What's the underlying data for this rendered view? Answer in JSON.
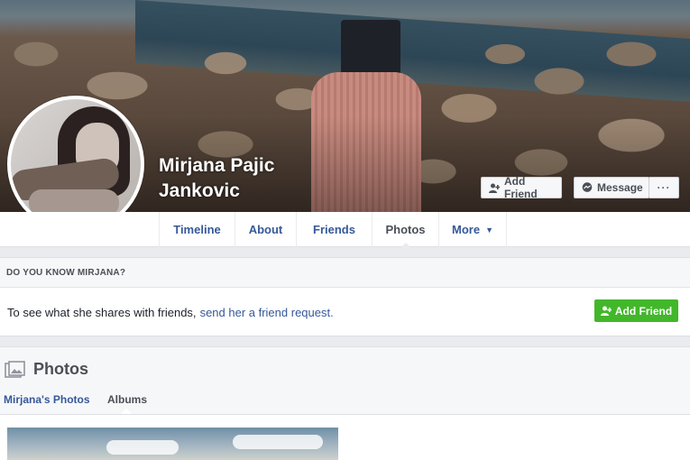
{
  "profile": {
    "name": "Mirjana Pajic Jankovic"
  },
  "cover_actions": {
    "add_friend_label": "Add Friend",
    "message_label": "Message",
    "more_label": "···"
  },
  "tabs": [
    {
      "label": "Timeline"
    },
    {
      "label": "About"
    },
    {
      "label": "Friends"
    },
    {
      "label": "Photos",
      "active": true
    },
    {
      "label": "More",
      "caret": "▼"
    }
  ],
  "know_panel": {
    "heading": "DO YOU KNOW MIRJANA?",
    "text": "To see what she shares with friends,",
    "link": "send her a friend request.",
    "button_label": "Add Friend"
  },
  "photos_panel": {
    "title": "Photos",
    "tabs": [
      {
        "label": "Mirjana's Photos"
      },
      {
        "label": "Albums",
        "active": true
      }
    ]
  },
  "colors": {
    "link": "#365899",
    "green": "#42b72a",
    "bg": "#e9ebee"
  }
}
